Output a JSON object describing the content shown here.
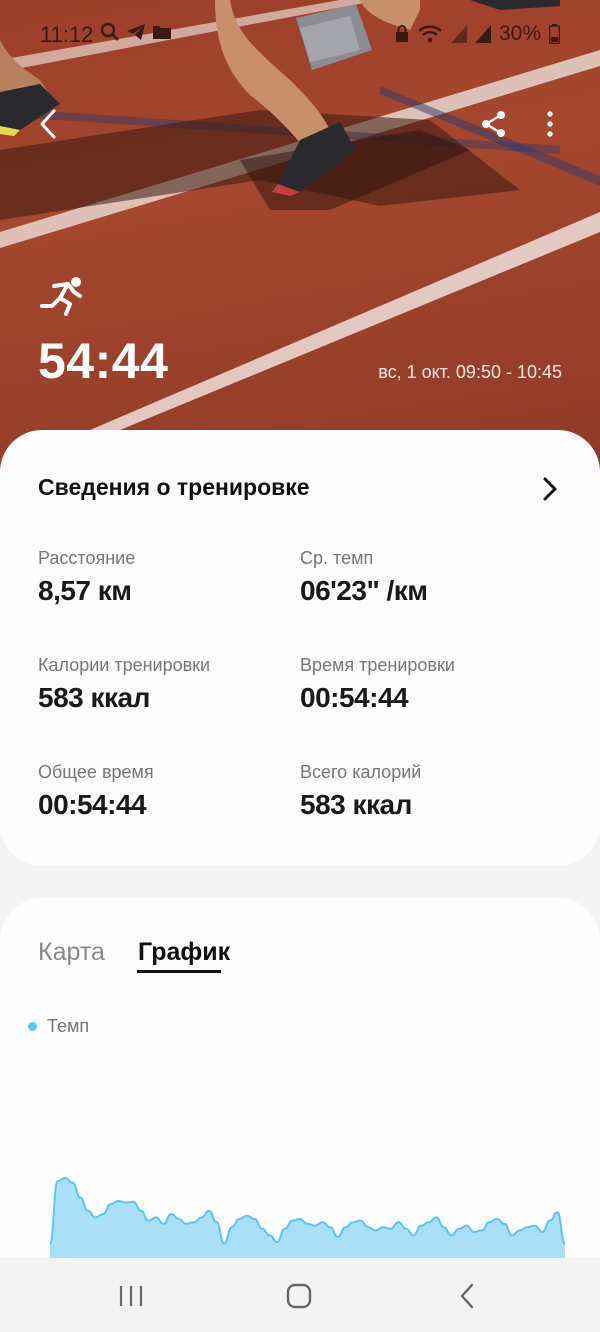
{
  "status_bar": {
    "time": "11:12",
    "battery": "30%"
  },
  "workout": {
    "activity_icon": "running-icon",
    "duration": "54:44",
    "date_range": "вс, 1 окт. 09:50 - 10:45"
  },
  "summary": {
    "title": "Сведения о тренировке",
    "metrics": [
      {
        "label": "Расстояние",
        "value": "8,57 км"
      },
      {
        "label": "Ср. темп",
        "value": "06'23\" /км"
      },
      {
        "label": "Калории тренировки",
        "value": "583 ккал"
      },
      {
        "label": "Время тренировки",
        "value": "00:54:44"
      },
      {
        "label": "Общее время",
        "value": "00:54:44"
      },
      {
        "label": "Всего калорий",
        "value": "583 ккал"
      }
    ]
  },
  "tabs": [
    {
      "label": "Карта",
      "selected": false
    },
    {
      "label": "График",
      "selected": true
    }
  ],
  "chart_data": {
    "type": "area",
    "series": [
      {
        "name": "Темп",
        "values": [
          20,
          96,
          100,
          94,
          76,
          60,
          52,
          56,
          68,
          72,
          70,
          71,
          60,
          48,
          52,
          44,
          56,
          50,
          44,
          46,
          52,
          60,
          46,
          20,
          40,
          50,
          54,
          50,
          38,
          30,
          22,
          38,
          48,
          50,
          44,
          42,
          46,
          40,
          28,
          40,
          46,
          48,
          40,
          36,
          40,
          38,
          46,
          38,
          30,
          42,
          46,
          52,
          40,
          30,
          38,
          42,
          34,
          36,
          46,
          50,
          44,
          30,
          36,
          40,
          42,
          34,
          48,
          58,
          20
        ]
      }
    ],
    "colors": {
      "fill": "#a9dff7",
      "line": "#5cc4f2"
    },
    "grid": false
  },
  "colors": {
    "accent": "#5cc4f2",
    "hero": "#a6472f"
  }
}
